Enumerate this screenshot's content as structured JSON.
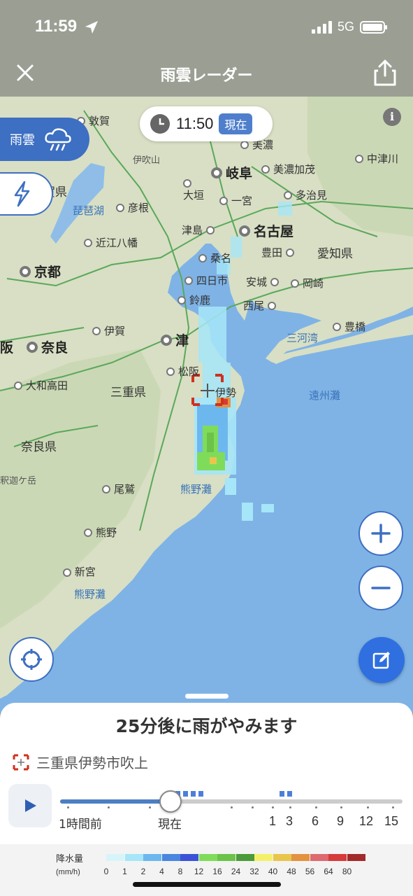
{
  "status": {
    "time": "11:59",
    "network": "5G"
  },
  "header": {
    "title": "雨雲レーダー"
  },
  "map": {
    "time": "11:50",
    "now_badge": "現在",
    "layer_rain_label": "雨雲",
    "info_label": "i",
    "places": {
      "tsuruga": "敦賀",
      "ibukiyama": "伊吹山",
      "mino": "美濃",
      "nakatsugawa": "中津川",
      "gifu": "岐阜",
      "minokamo": "美濃加茂",
      "ogaki": "大垣",
      "ichinomiya": "一宮",
      "tajimi": "多治見",
      "hikone": "彦根",
      "biwako": "琵琶湖",
      "shigaken": "賀県",
      "tsushima": "津島",
      "nagoya": "名古屋",
      "omihachiman": "近江八幡",
      "kuwana": "桑名",
      "toyota": "豊田",
      "aichiken": "愛知県",
      "kyoto": "京都",
      "yokkaichi": "四日市",
      "anjo": "安城",
      "okazaki": "岡崎",
      "suzuka": "鈴鹿",
      "nishio": "西尾",
      "iga": "伊賀",
      "mikawawan": "三河湾",
      "toyohashi": "豊橋",
      "osaka": "阪",
      "nara": "奈良",
      "tsu": "津",
      "matsusaka": "松阪",
      "ise": "伊勢",
      "enshunada": "遠州灘",
      "yamatotakada": "大和高田",
      "mieken": "三重県",
      "naraken": "奈良県",
      "shakagatake": "釈迦ケ岳",
      "owase": "尾鷲",
      "kumanonada": "熊野灘",
      "kumano": "熊野",
      "shingu": "新宮"
    }
  },
  "sheet": {
    "title": "25分後に雨がやみます",
    "location": "三重県伊勢市吹上",
    "timeline_labels": {
      "past": "1時間前",
      "now": "現在",
      "h1": "1",
      "h3": "3",
      "h6": "6",
      "h9": "9",
      "h12": "12",
      "h15": "15"
    },
    "progress": 0.32
  },
  "legend": {
    "title": "降水量",
    "unit": "(mm/h)",
    "values": [
      "0",
      "1",
      "2",
      "4",
      "8",
      "12",
      "16",
      "24",
      "32",
      "40",
      "48",
      "56",
      "64",
      "80"
    ],
    "colors": [
      "#d8f4fb",
      "#a6e6f8",
      "#6cb8ee",
      "#4a86e0",
      "#3c52d6",
      "#7fdc5a",
      "#6cc24a",
      "#4d9a38",
      "#f4f06a",
      "#e8c64c",
      "#e49240",
      "#dd6a70",
      "#d63a3a",
      "#a32a2a"
    ]
  }
}
